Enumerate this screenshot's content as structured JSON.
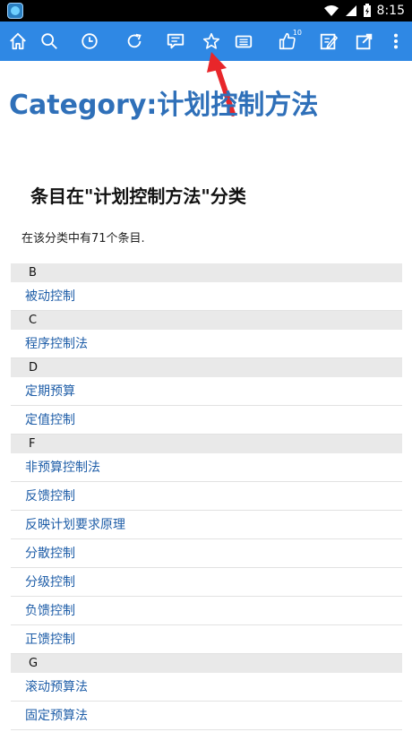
{
  "status_bar": {
    "time": "8:15"
  },
  "toolbar": {
    "icons": [
      "home-icon",
      "search-icon",
      "history-icon",
      "refresh-icon",
      "comment-icon",
      "star-icon",
      "list-icon",
      "like-icon",
      "edit-icon",
      "share-icon",
      "more-icon"
    ],
    "like_count": "10"
  },
  "page": {
    "title": "Category:计划控制方法",
    "subheading": "条目在\"计划控制方法\"分类",
    "count_text": "在该分类中有71个条目."
  },
  "groups": [
    {
      "letter": "B",
      "items": [
        "被动控制"
      ]
    },
    {
      "letter": "C",
      "items": [
        "程序控制法"
      ]
    },
    {
      "letter": "D",
      "items": [
        "定期预算",
        "定值控制"
      ]
    },
    {
      "letter": "F",
      "items": [
        "非预算控制法",
        "反馈控制",
        "反映计划要求原理",
        "分散控制",
        "分级控制",
        "负馈控制",
        "正馈控制"
      ]
    },
    {
      "letter": "G",
      "items": [
        "滚动预算法",
        "固定预算法"
      ]
    }
  ],
  "colors": {
    "toolbar": "#2f88e4",
    "title": "#2f70b9",
    "link": "#1f5ea8",
    "arrow": "#e8262a"
  }
}
